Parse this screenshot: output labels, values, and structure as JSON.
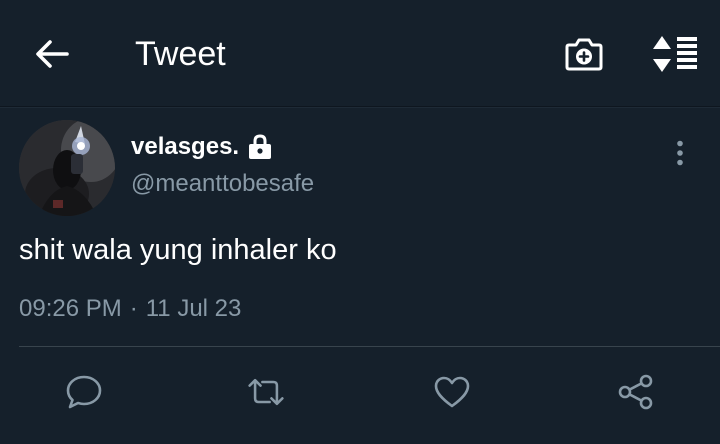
{
  "header": {
    "title": "Tweet",
    "back_icon": "arrow-left-icon",
    "camera_icon": "camera-plus-icon",
    "sort_icon": "sort-list-icon"
  },
  "tweet": {
    "display_name": "velasges.",
    "protected_icon": "lock-icon",
    "handle": "@meanttobesafe",
    "text": "shit wala yung inhaler ko",
    "time": "09:26 PM",
    "separator": "·",
    "date": "11 Jul 23"
  },
  "actions": {
    "reply_icon": "reply-icon",
    "retweet_icon": "retweet-icon",
    "like_icon": "heart-icon",
    "share_icon": "share-icon"
  },
  "colors": {
    "background": "#15202b",
    "primary_text": "#ffffff",
    "secondary_text": "#8899a6",
    "divider": "#38444d"
  }
}
